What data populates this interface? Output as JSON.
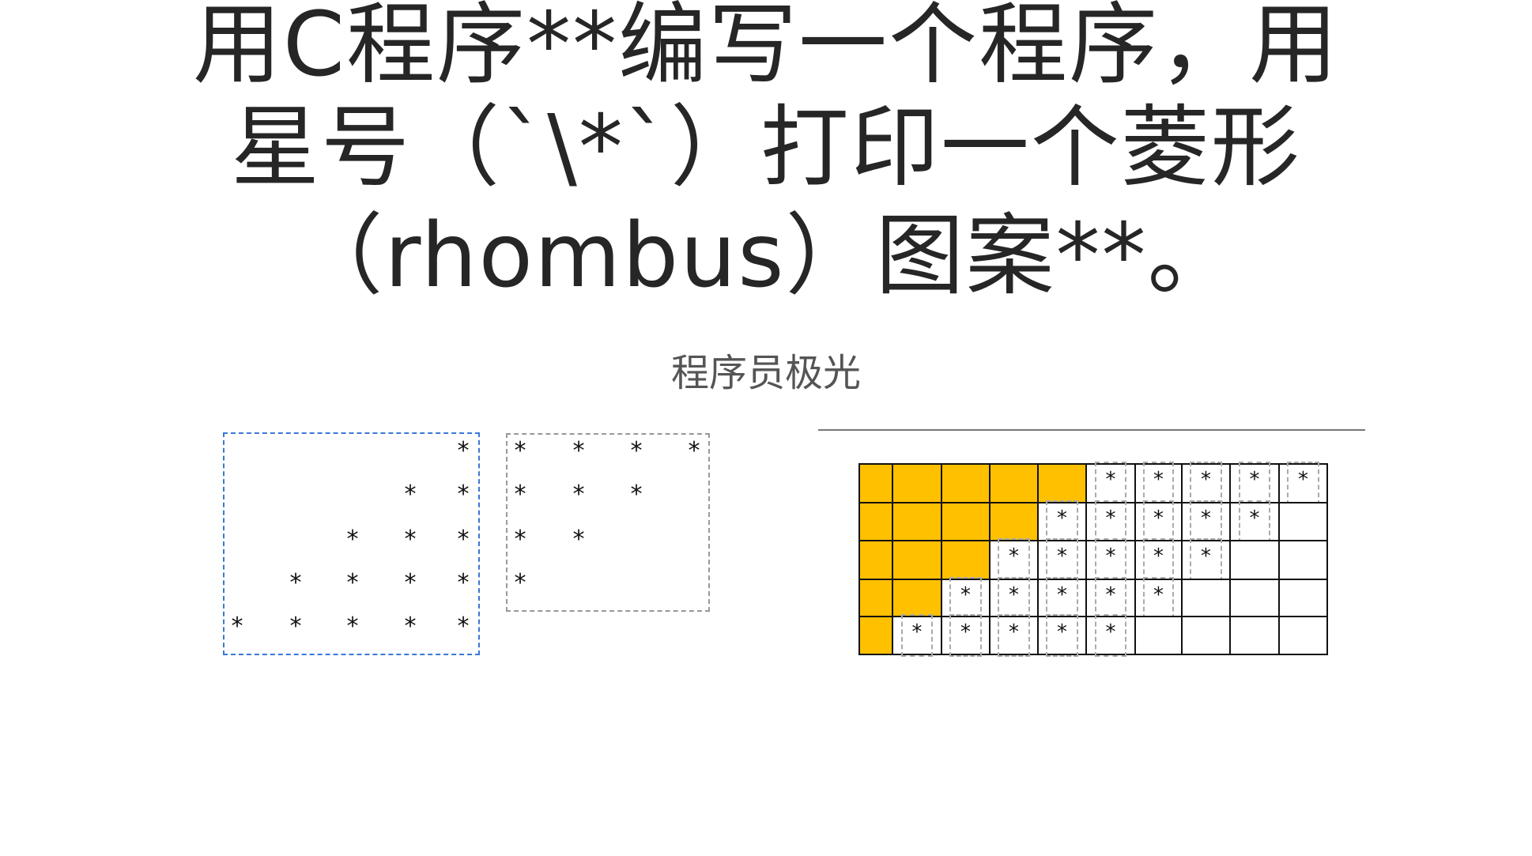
{
  "title_lines": [
    "用C程序**编写一个程序，用",
    "星号（`\\*`）打印一个菱形",
    "（rhombus）图案**。"
  ],
  "subtitle": "程序员极光",
  "star_char": "*",
  "left_triangle": {
    "rows": 5,
    "pattern": "right-aligned increasing",
    "border_color": "#3a78d8"
  },
  "right_triangle": {
    "rows": 4,
    "pattern": "left-aligned decreasing",
    "border_color": "#999999"
  },
  "grid": {
    "rows": 5,
    "cols": 10,
    "fill_color": "#ffc000",
    "yellow_counts": [
      5,
      4,
      3,
      2,
      1
    ],
    "star_start_cols": [
      5,
      4,
      3,
      2,
      1
    ],
    "star_counts": [
      5,
      5,
      5,
      5,
      5
    ]
  }
}
